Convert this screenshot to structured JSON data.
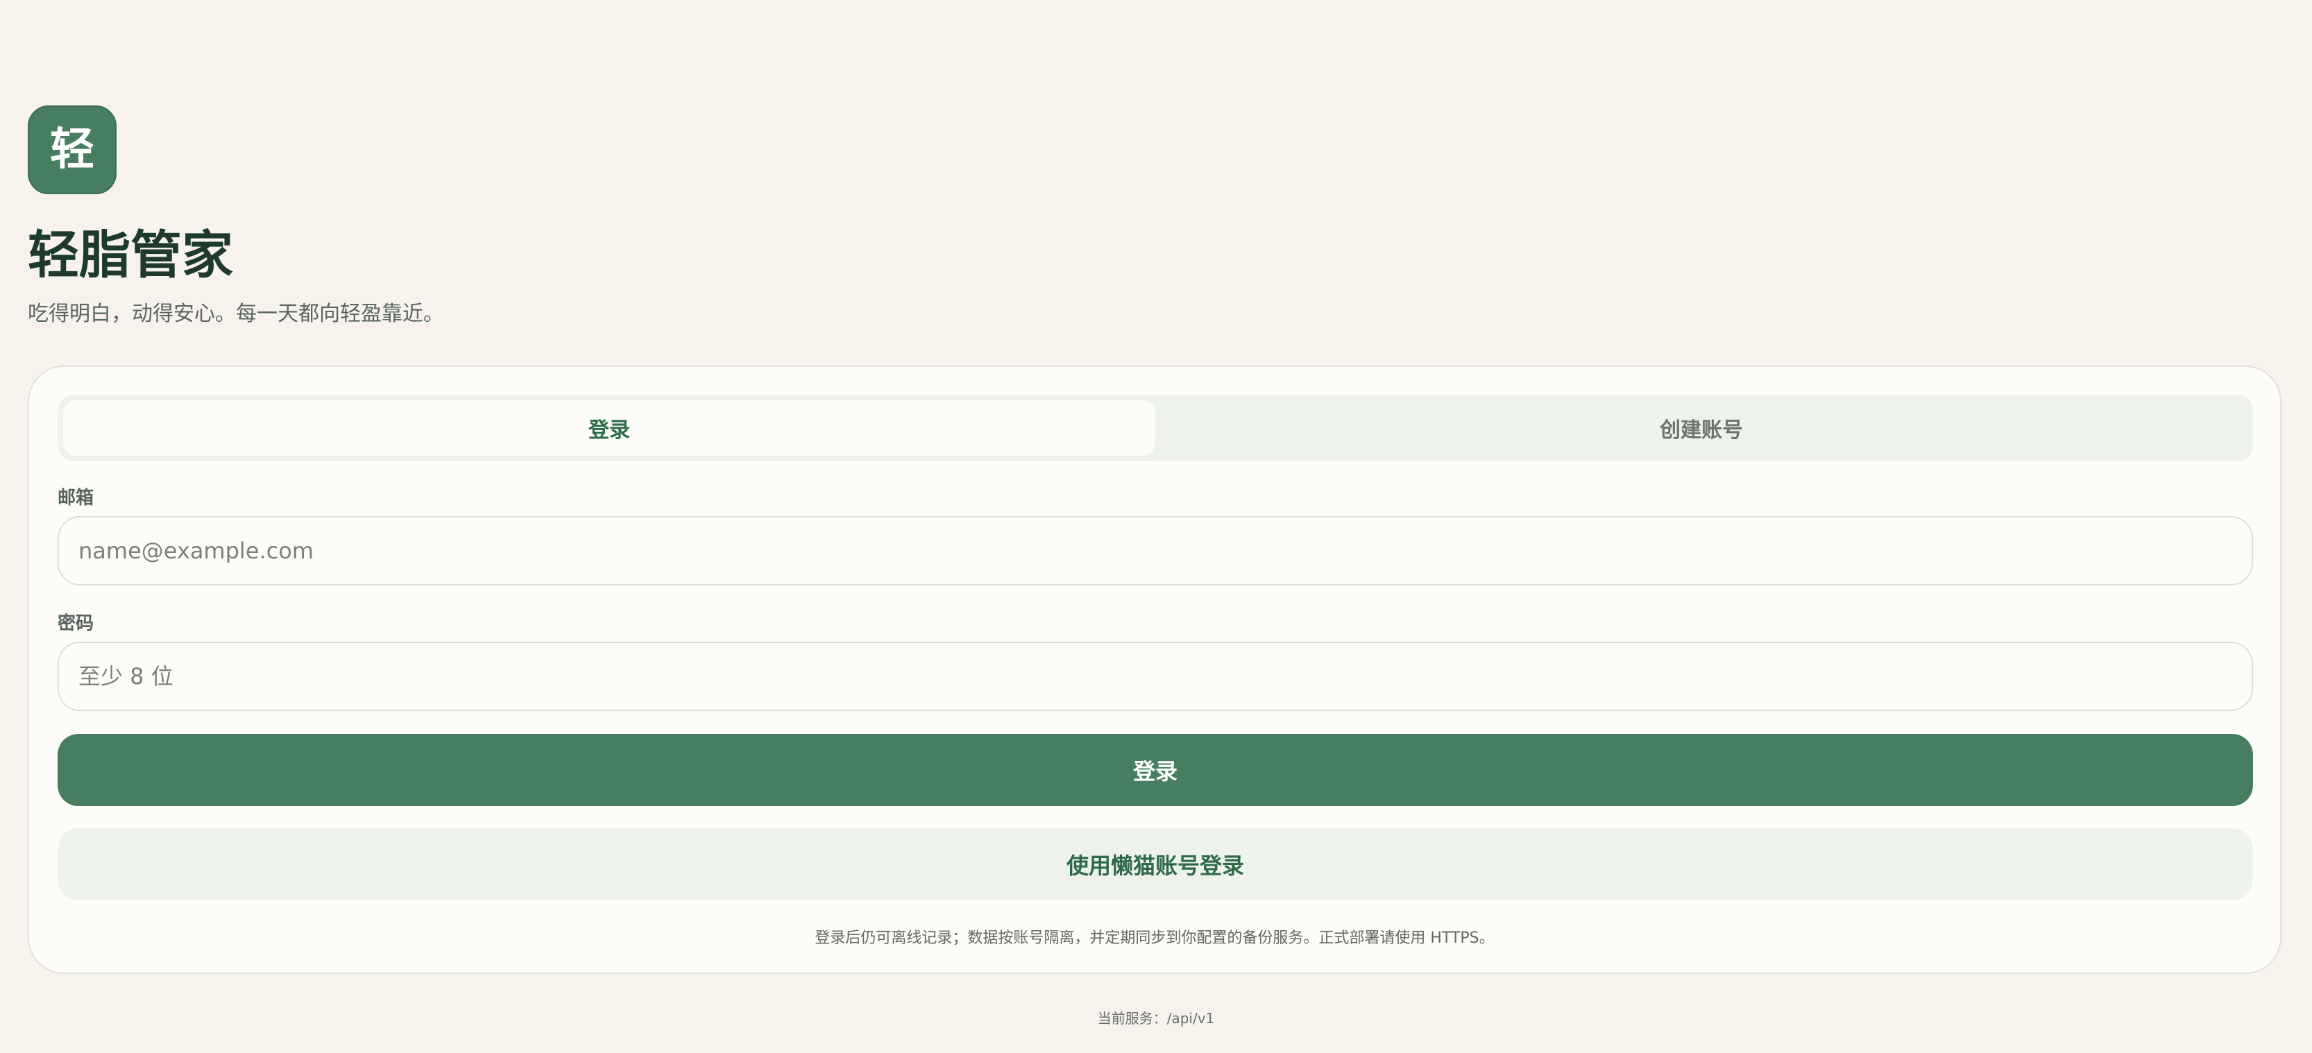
{
  "app": {
    "logo_char": "轻",
    "title": "轻脂管家",
    "subtitle": "吃得明白，动得安心。每一天都向轻盈靠近。"
  },
  "auth": {
    "tabs": [
      {
        "label": "登录",
        "active": true
      },
      {
        "label": "创建账号",
        "active": false
      }
    ],
    "email": {
      "label": "邮箱",
      "placeholder": "name@example.com",
      "value": ""
    },
    "password": {
      "label": "密码",
      "placeholder": "至少 8 位",
      "value": ""
    },
    "login_button": "登录",
    "alt_login_button": "使用懒猫账号登录",
    "note": "登录后仍可离线记录；数据按账号隔离，并定期同步到你配置的备份服务。正式部署请使用 HTTPS。"
  },
  "footer": {
    "service": "当前服务：/api/v1"
  },
  "colors": {
    "background": "#f7f3ec",
    "accent": "#477e5f",
    "accent_text": "#2e6a47",
    "soft_green": "#edf2ea"
  }
}
